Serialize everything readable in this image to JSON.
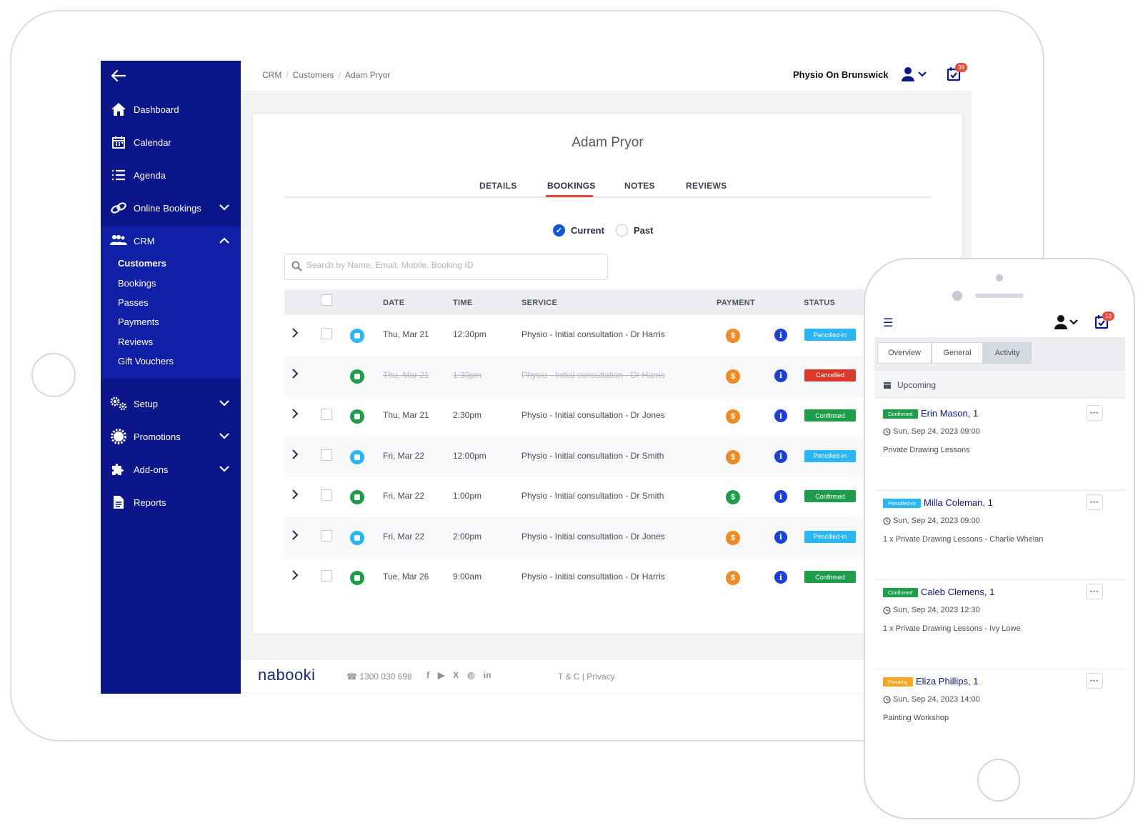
{
  "sidebar": {
    "items": [
      {
        "label": "Dashboard",
        "icon": "home-icon"
      },
      {
        "label": "Calendar",
        "icon": "calendar-icon"
      },
      {
        "label": "Agenda",
        "icon": "list-icon"
      },
      {
        "label": "Online Bookings",
        "icon": "link-icon"
      },
      {
        "label": "CRM",
        "icon": "users-icon"
      },
      {
        "label": "Setup",
        "icon": "gears-icon"
      },
      {
        "label": "Promotions",
        "icon": "badge-icon"
      },
      {
        "label": "Add-ons",
        "icon": "puzzle-icon"
      },
      {
        "label": "Reports",
        "icon": "file-icon"
      }
    ],
    "crm_sub": [
      "Customers",
      "Bookings",
      "Passes",
      "Payments",
      "Reviews",
      "Gift Vouchers"
    ]
  },
  "topbar": {
    "breadcrumb": [
      "CRM",
      "Customers",
      "Adam Pryor"
    ],
    "org_name": "Physio On Brunswick",
    "notif_count": "39"
  },
  "customer": {
    "name": "Adam Pryor",
    "tabs": [
      "DETAILS",
      "BOOKINGS",
      "NOTES",
      "REVIEWS"
    ],
    "active_tab": "BOOKINGS",
    "filter": {
      "current": "Current",
      "past": "Past",
      "selected": "Current"
    },
    "search_placeholder": "Search by Name, Email, Mobile, Booking ID"
  },
  "table": {
    "headers": {
      "date": "DATE",
      "time": "TIME",
      "service": "SERVICE",
      "payment": "PAYMENT",
      "status": "STATUS"
    },
    "rows": [
      {
        "date": "Thu, Mar 21",
        "time": "12:30pm",
        "service": "Physio - Initial consultation - Dr Harris",
        "status": "Pencilled-in",
        "type_color": "#29b6f6",
        "pay_color": "#f08a24",
        "status_color": "#29b6f6",
        "checkbox": true,
        "cancelled": false
      },
      {
        "date": "Thu, Mar 21",
        "time": "1:30pm",
        "service": "Physio - Initial consultation - Dr Harris",
        "status": "Cancelled",
        "type_color": "#1e9e4a",
        "pay_color": "#f08a24",
        "status_color": "#d93a2b",
        "checkbox": false,
        "cancelled": true
      },
      {
        "date": "Thu, Mar 21",
        "time": "2:30pm",
        "service": "Physio - Initial consultation - Dr Jones",
        "status": "Confirmed",
        "type_color": "#1e9e4a",
        "pay_color": "#f08a24",
        "status_color": "#1e9e4a",
        "checkbox": true,
        "cancelled": false
      },
      {
        "date": "Fri, Mar 22",
        "time": "12:00pm",
        "service": "Physio - Initial consultation - Dr Smith",
        "status": "Pencilled-in",
        "type_color": "#29b6f6",
        "pay_color": "#f08a24",
        "status_color": "#29b6f6",
        "checkbox": true,
        "cancelled": false
      },
      {
        "date": "Fri, Mar 22",
        "time": "1:00pm",
        "service": "Physio - Initial consultation - Dr Smith",
        "status": "Confirmed",
        "type_color": "#1e9e4a",
        "pay_color": "#1e9e4a",
        "status_color": "#1e9e4a",
        "checkbox": true,
        "cancelled": false
      },
      {
        "date": "Fri, Mar 22",
        "time": "2:00pm",
        "service": "Physio - Initial consultation - Dr Jones",
        "status": "Pencilled-in",
        "type_color": "#29b6f6",
        "pay_color": "#f08a24",
        "status_color": "#29b6f6",
        "checkbox": true,
        "cancelled": false
      },
      {
        "date": "Tue, Mar 26",
        "time": "9:00am",
        "service": "Physio - Initial consultation - Dr Harris",
        "status": "Confirmed",
        "type_color": "#1e9e4a",
        "pay_color": "#f08a24",
        "status_color": "#1e9e4a",
        "checkbox": true,
        "cancelled": false
      }
    ]
  },
  "footer": {
    "logo": "nabooki",
    "phone": "1300 030 698",
    "social": [
      "f",
      "▶",
      "X",
      "◎",
      "in"
    ],
    "links": "T & C | Privacy"
  },
  "mobile": {
    "notif_count": "12",
    "tabs": [
      "Overview",
      "General",
      "Activity"
    ],
    "active_tab": "Activity",
    "section": "Upcoming",
    "items": [
      {
        "status": "Confirmed",
        "status_color": "#1e9e4a",
        "name": "Erin Mason, 1",
        "time": "Sun, Sep 24, 2023 09:00",
        "desc": "Private Drawing Lessons"
      },
      {
        "status": "Pencilled-in",
        "status_color": "#29b6f6",
        "name": "Milla Coleman, 1",
        "time": "Sun, Sep 24, 2023 09:00",
        "desc": "1 x Private Drawing Lessons - Charlie Whelan"
      },
      {
        "status": "Confirmed",
        "status_color": "#1e9e4a",
        "name": "Caleb Clemens, 1",
        "time": "Sun, Sep 24, 2023 12:30",
        "desc": "1 x Private Drawing Lessons - Ivy Lowe"
      },
      {
        "status": "Pending",
        "status_color": "#f5a623",
        "name": "Eliza Phillips, 1",
        "time": "Sun, Sep 24, 2023 14:00",
        "desc": "Painting Workshop"
      }
    ]
  },
  "colors": {
    "sidebar": "#0b168a",
    "accent": "#e14a3a",
    "primary": "#1356d6"
  }
}
